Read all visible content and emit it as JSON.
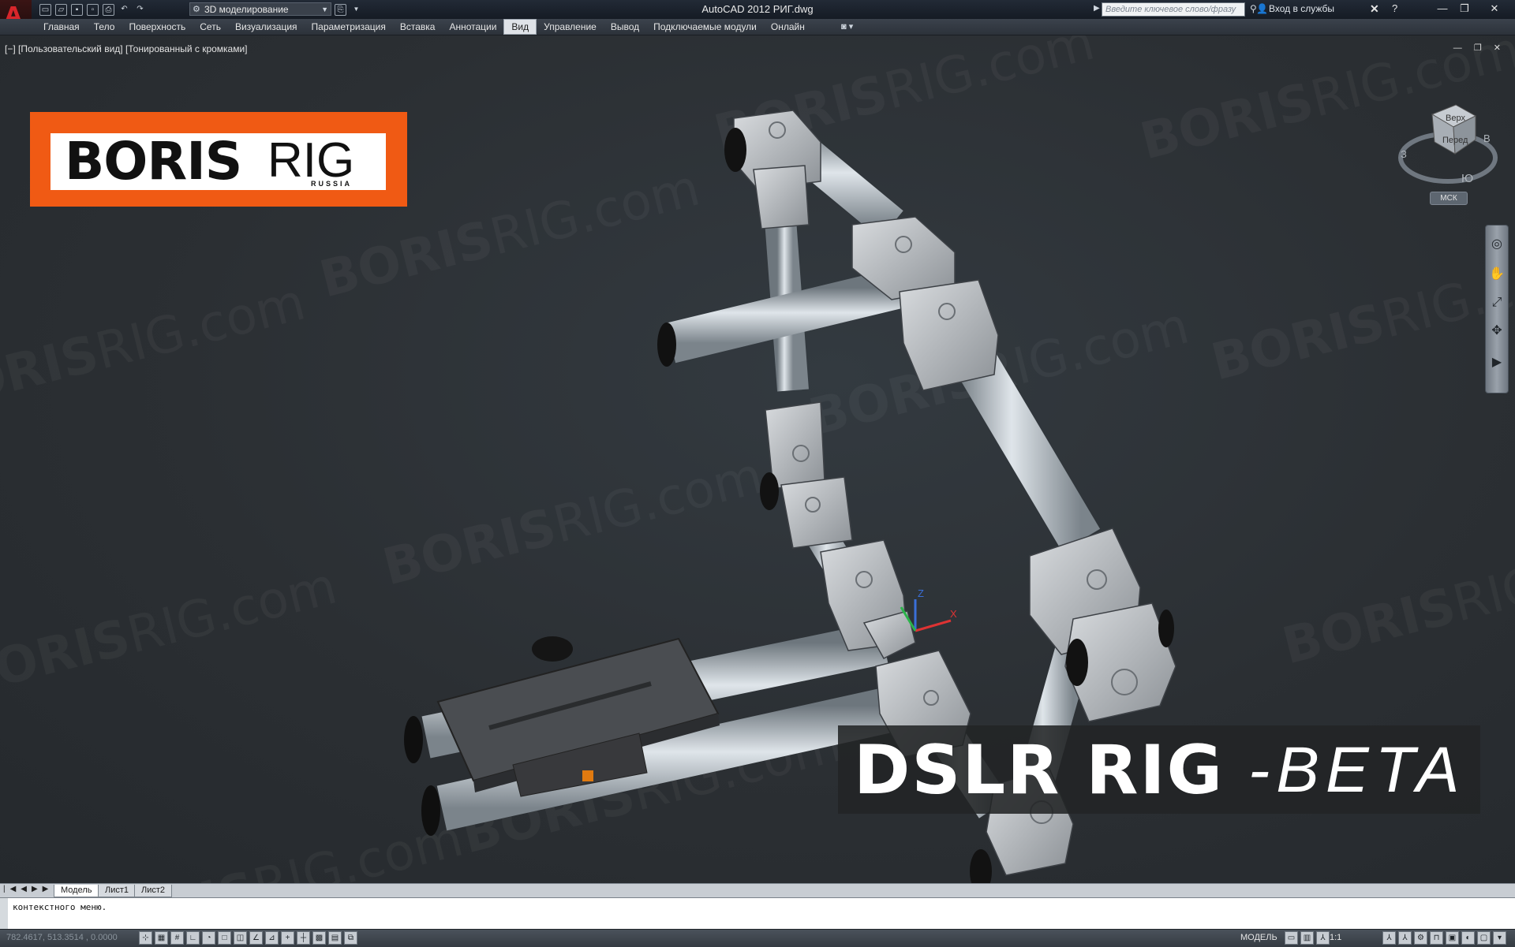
{
  "app": {
    "title": "AutoCAD 2012    РИГ.dwg",
    "workspace": "3D моделирование",
    "search_placeholder": "Введите ключевое слово/фразу",
    "signin": "Вход в службы"
  },
  "menu": {
    "tabs": [
      "Главная",
      "Тело",
      "Поверхность",
      "Сеть",
      "Визуализация",
      "Параметризация",
      "Вставка",
      "Аннотации",
      "Вид",
      "Управление",
      "Вывод",
      "Подключаемые модули",
      "Онлайн"
    ],
    "active_tab": "Вид"
  },
  "viewport": {
    "label": "[−] [Пользовательский вид] [Тонированный с кромками]",
    "logo": {
      "bold": "BORIS",
      "light": "RIG",
      "sub": "RUSSIA"
    },
    "overlay": {
      "bold": "DSLR RIG",
      "script": "-BETA"
    },
    "watermark": {
      "bold": "BORIS",
      "light": "RIG.com"
    },
    "viewcube": {
      "top": "Верх",
      "front": "Перед",
      "west": "З",
      "east": "В",
      "south": "Ю"
    },
    "ucs_label": "МСК",
    "axes": {
      "x": "X",
      "y": "Y",
      "z": "Z"
    }
  },
  "layout_tabs": [
    "Модель",
    "Лист1",
    "Лист2"
  ],
  "command_line": {
    "text": "контекстного меню."
  },
  "status": {
    "coords": "782.4617, 513.3514 , 0.0000",
    "model": "МОДЕЛЬ",
    "scale": "1:1"
  },
  "colors": {
    "accent_logo": "#f05a14",
    "title_bg": "#1a2029",
    "viewport_bg": "#2b2f33"
  }
}
